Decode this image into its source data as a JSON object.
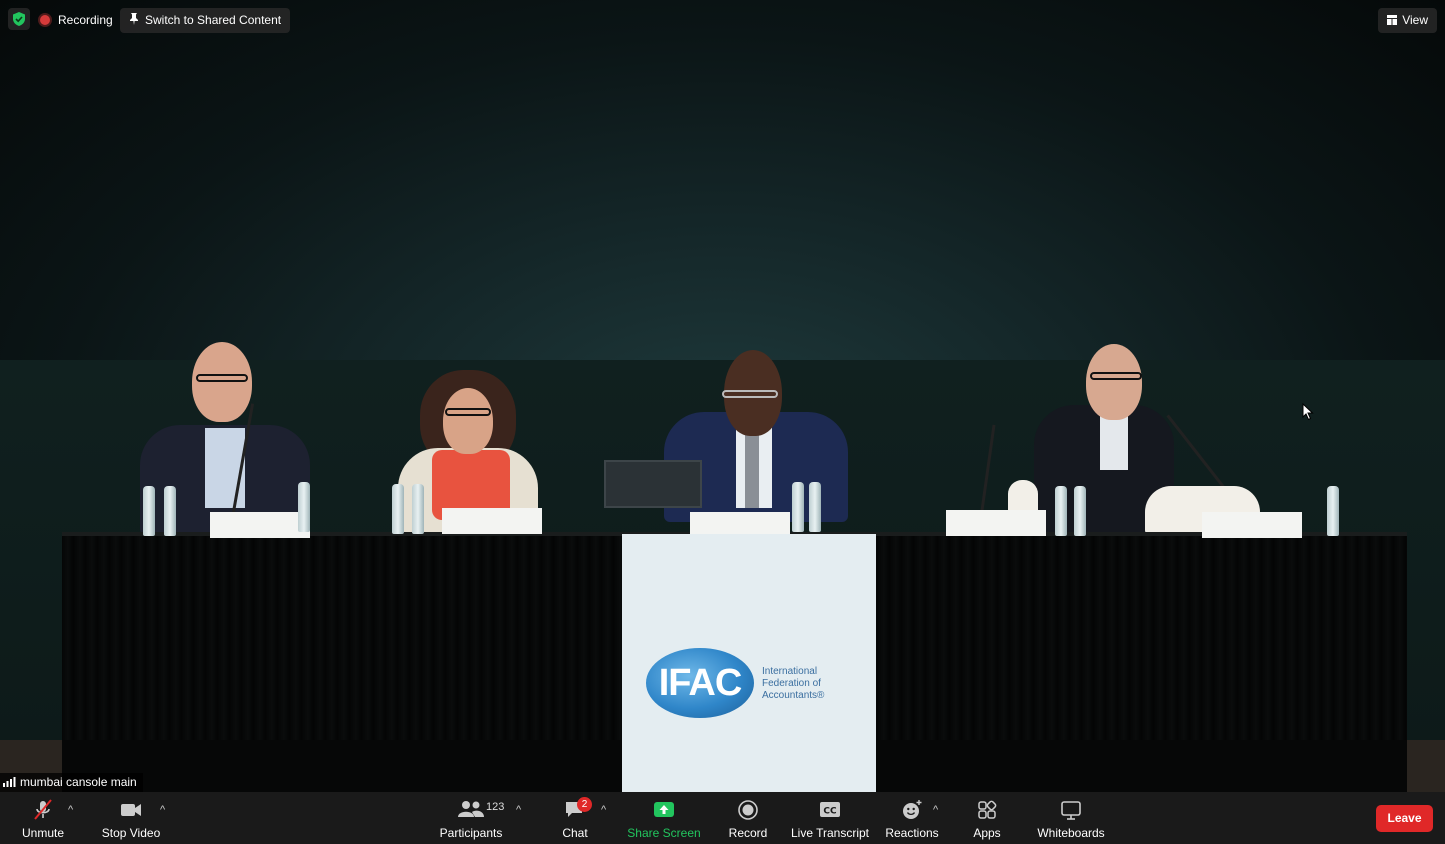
{
  "top": {
    "recording_label": "Recording",
    "switch_label": "Switch to Shared Content",
    "view_label": "View"
  },
  "video": {
    "participant_name": "mumbai cansole main",
    "banner_logo": "IFAC",
    "banner_text": "International Federation of Accountants®",
    "nameplates": [
      "",
      "",
      "",
      "",
      ""
    ]
  },
  "toolbar": {
    "unmute": "Unmute",
    "stop_video": "Stop Video",
    "participants": "Participants",
    "participants_count": "123",
    "chat": "Chat",
    "chat_badge": "2",
    "share_screen": "Share Screen",
    "record": "Record",
    "live_transcript": "Live Transcript",
    "reactions": "Reactions",
    "apps": "Apps",
    "whiteboards": "Whiteboards",
    "leave": "Leave"
  },
  "colors": {
    "leave": "#e02828",
    "share": "#22c55e",
    "toolbar": "#1a1a1a"
  }
}
